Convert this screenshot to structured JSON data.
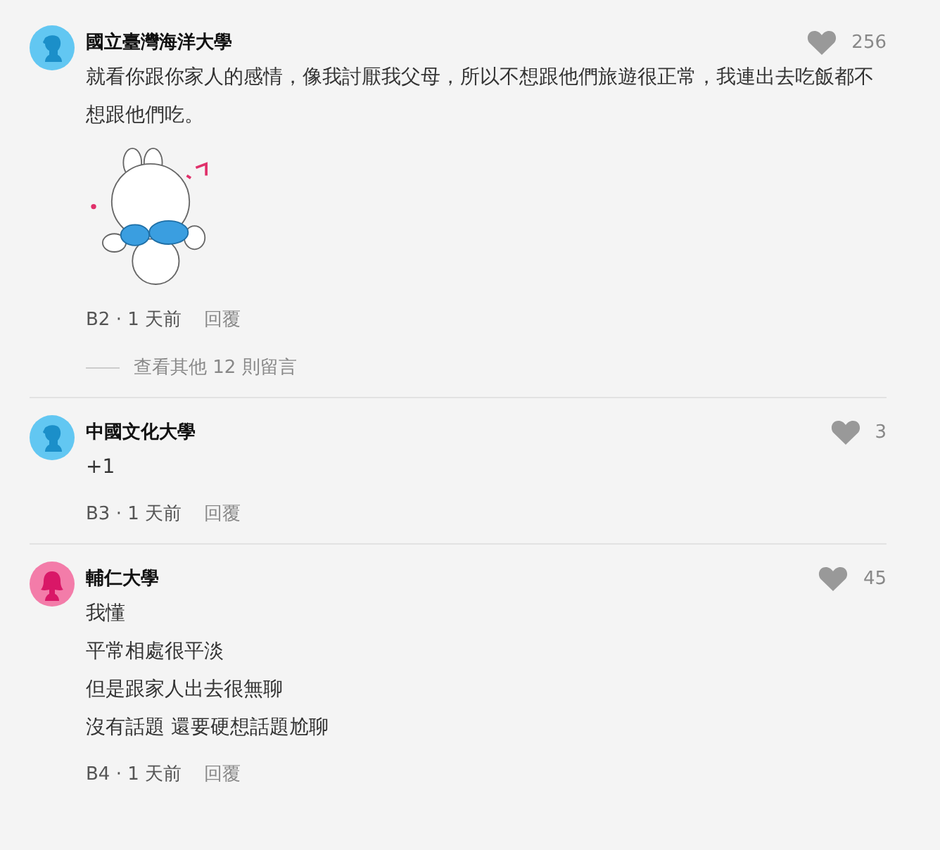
{
  "comments": [
    {
      "author": "國立臺灣海洋大學",
      "avatar": {
        "kind": "male"
      },
      "likes": "256",
      "lines": [
        "就看你跟你家人的感情，像我討厭我父母，所以不想跟他們旅遊很正常，我連出去吃飯都不想跟他們吃。"
      ],
      "sticker": true,
      "meta": "B2 · 1 天前",
      "reply": "回覆",
      "more_replies": "查看其他 12 則留言"
    },
    {
      "author": "中國文化大學",
      "avatar": {
        "kind": "male"
      },
      "likes": "3",
      "lines": [
        "+1"
      ],
      "sticker": false,
      "meta": "B3 · 1 天前",
      "reply": "回覆"
    },
    {
      "author": "輔仁大學",
      "avatar": {
        "kind": "female"
      },
      "likes": "45",
      "lines": [
        "我懂",
        "平常相處很平淡",
        "但是跟家人出去很無聊",
        "沒有話題 還要硬想話題尬聊"
      ],
      "sticker": false,
      "meta": "B4 · 1 天前",
      "reply": "回覆"
    }
  ]
}
